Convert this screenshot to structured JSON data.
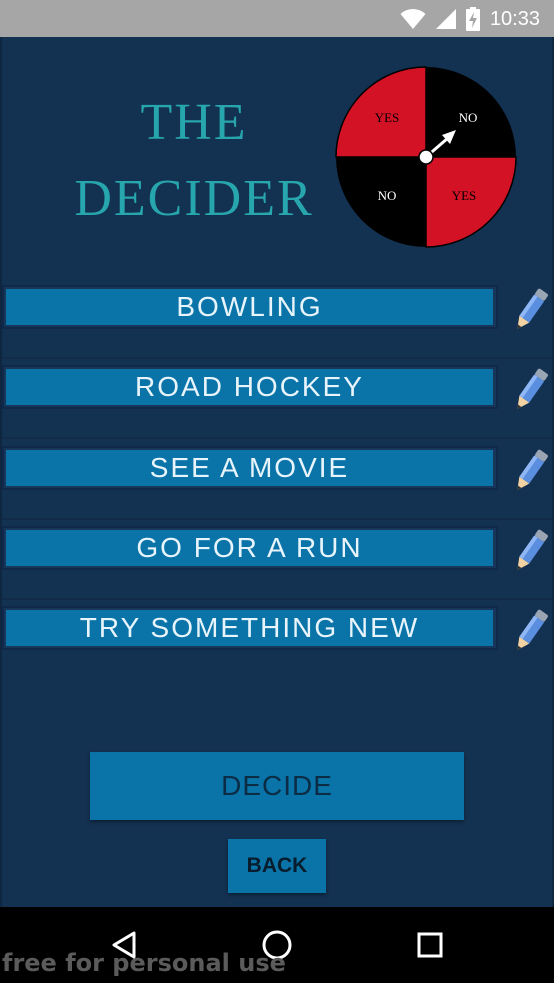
{
  "status_bar": {
    "time": "10:33"
  },
  "app": {
    "title_line1": "THE",
    "title_line2": "DECIDER",
    "wheel": {
      "segments": [
        {
          "label": "YES",
          "color": "#d41226"
        },
        {
          "label": "NO",
          "color": "#000000"
        },
        {
          "label": "NO",
          "color": "#000000"
        },
        {
          "label": "YES",
          "color": "#d41226"
        }
      ]
    },
    "options": [
      {
        "label": "BOWLING"
      },
      {
        "label": "ROAD HOCKEY"
      },
      {
        "label": "SEE A MOVIE"
      },
      {
        "label": "GO FOR A RUN"
      },
      {
        "label": "TRY SOMETHING NEW"
      }
    ],
    "decide_label": "DECIDE",
    "back_label": "BACK"
  },
  "nav_bar": {
    "icons": [
      "back-icon",
      "home-icon",
      "recents-icon"
    ]
  },
  "watermark": "free for personal use",
  "colors": {
    "background": "#133150",
    "button": "#0a74a8",
    "title": "#27a6ad",
    "wheel_red": "#d41226"
  }
}
